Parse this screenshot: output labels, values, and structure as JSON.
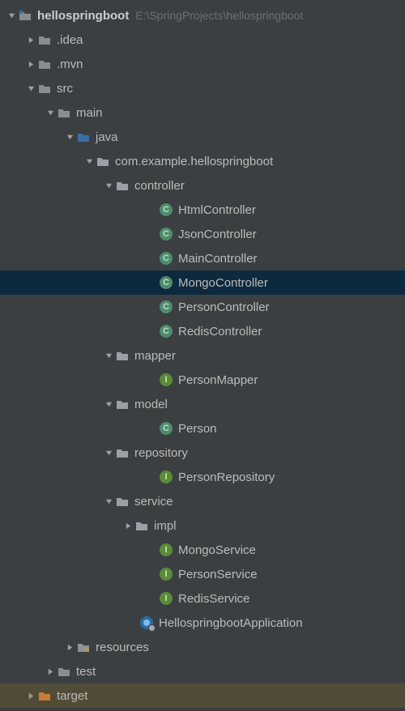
{
  "project": {
    "name": "hellospringboot",
    "path_hint": "E:\\SpringProjects\\hellospringboot"
  },
  "folders": {
    "idea": ".idea",
    "mvn": ".mvn",
    "src": "src",
    "main": "main",
    "java": "java",
    "package": "com.example.hellospringboot",
    "controller": "controller",
    "mapper": "mapper",
    "model": "model",
    "repository": "repository",
    "service": "service",
    "impl": "impl",
    "resources": "resources",
    "test": "test",
    "target": "target"
  },
  "classes": {
    "htmlController": "HtmlController",
    "jsonController": "JsonController",
    "mainController": "MainController",
    "mongoController": "MongoController",
    "personController": "PersonController",
    "redisController": "RedisController",
    "personMapper": "PersonMapper",
    "person": "Person",
    "personRepository": "PersonRepository",
    "mongoService": "MongoService",
    "personService": "PersonService",
    "redisService": "RedisService",
    "app": "HellospringbootApplication"
  },
  "colors": {
    "folder_default": "#8a8c8e",
    "folder_src": "#3a6ea8",
    "folder_package": "#9aa0a6",
    "folder_resources": "#8f9196",
    "folder_target": "#c97b3a",
    "selected_bg": "#0d293e",
    "highlight_bg": "rgba(120,100,40,0.35)"
  },
  "tree_structure": [
    {
      "id": "root",
      "depth": 0,
      "arrow": "down",
      "icon": "module",
      "label_key": "project.name",
      "bold": true,
      "hint_key": "project.path_hint"
    },
    {
      "id": "idea",
      "depth": 1,
      "arrow": "right",
      "icon": "folder",
      "color": "folder_default",
      "label_key": "folders.idea"
    },
    {
      "id": "mvn",
      "depth": 1,
      "arrow": "right",
      "icon": "folder",
      "color": "folder_default",
      "label_key": "folders.mvn"
    },
    {
      "id": "src",
      "depth": 1,
      "arrow": "down",
      "icon": "folder",
      "color": "folder_default",
      "label_key": "folders.src"
    },
    {
      "id": "main",
      "depth": 2,
      "arrow": "down",
      "icon": "folder",
      "color": "folder_default",
      "label_key": "folders.main"
    },
    {
      "id": "java",
      "depth": 3,
      "arrow": "down",
      "icon": "folder",
      "color": "folder_src",
      "label_key": "folders.java"
    },
    {
      "id": "package",
      "depth": 4,
      "arrow": "down",
      "icon": "folder",
      "color": "folder_package",
      "label_key": "folders.package"
    },
    {
      "id": "controller",
      "depth": 5,
      "arrow": "down",
      "icon": "folder",
      "color": "folder_package",
      "label_key": "folders.controller"
    },
    {
      "id": "htmlController",
      "depth": 6,
      "arrow": "none",
      "icon": "class-c",
      "label_key": "classes.htmlController"
    },
    {
      "id": "jsonController",
      "depth": 6,
      "arrow": "none",
      "icon": "class-c",
      "label_key": "classes.jsonController"
    },
    {
      "id": "mainController",
      "depth": 6,
      "arrow": "none",
      "icon": "class-c",
      "label_key": "classes.mainController"
    },
    {
      "id": "mongoController",
      "depth": 6,
      "arrow": "none",
      "icon": "class-c",
      "label_key": "classes.mongoController",
      "selected": true
    },
    {
      "id": "personController",
      "depth": 6,
      "arrow": "none",
      "icon": "class-c",
      "label_key": "classes.personController"
    },
    {
      "id": "redisController",
      "depth": 6,
      "arrow": "none",
      "icon": "class-c",
      "label_key": "classes.redisController"
    },
    {
      "id": "mapper",
      "depth": 5,
      "arrow": "down",
      "icon": "folder",
      "color": "folder_package",
      "label_key": "folders.mapper"
    },
    {
      "id": "personMapper",
      "depth": 6,
      "arrow": "none",
      "icon": "class-i",
      "label_key": "classes.personMapper"
    },
    {
      "id": "model",
      "depth": 5,
      "arrow": "down",
      "icon": "folder",
      "color": "folder_package",
      "label_key": "folders.model"
    },
    {
      "id": "person",
      "depth": 6,
      "arrow": "none",
      "icon": "class-c",
      "label_key": "classes.person"
    },
    {
      "id": "repository",
      "depth": 5,
      "arrow": "down",
      "icon": "folder",
      "color": "folder_package",
      "label_key": "folders.repository"
    },
    {
      "id": "personRepository",
      "depth": 6,
      "arrow": "none",
      "icon": "class-i",
      "label_key": "classes.personRepository"
    },
    {
      "id": "service",
      "depth": 5,
      "arrow": "down",
      "icon": "folder",
      "color": "folder_package",
      "label_key": "folders.service"
    },
    {
      "id": "impl",
      "depth": 6,
      "arrow": "right",
      "icon": "folder",
      "color": "folder_package",
      "label_key": "folders.impl"
    },
    {
      "id": "mongoService",
      "depth": 6,
      "arrow": "none",
      "icon": "class-i",
      "label_key": "classes.mongoService"
    },
    {
      "id": "personService",
      "depth": 6,
      "arrow": "none",
      "icon": "class-i",
      "label_key": "classes.personService"
    },
    {
      "id": "redisService",
      "depth": 6,
      "arrow": "none",
      "icon": "class-i",
      "label_key": "classes.redisService"
    },
    {
      "id": "app",
      "depth": 5,
      "arrow": "none",
      "icon": "app",
      "label_key": "classes.app"
    },
    {
      "id": "resources",
      "depth": 3,
      "arrow": "right",
      "icon": "folder-res",
      "color": "folder_resources",
      "label_key": "folders.resources"
    },
    {
      "id": "test",
      "depth": 2,
      "arrow": "right",
      "icon": "folder",
      "color": "folder_default",
      "label_key": "folders.test"
    },
    {
      "id": "target",
      "depth": 1,
      "arrow": "right",
      "icon": "folder",
      "color": "folder_target",
      "label_key": "folders.target",
      "highlighted": true
    }
  ]
}
